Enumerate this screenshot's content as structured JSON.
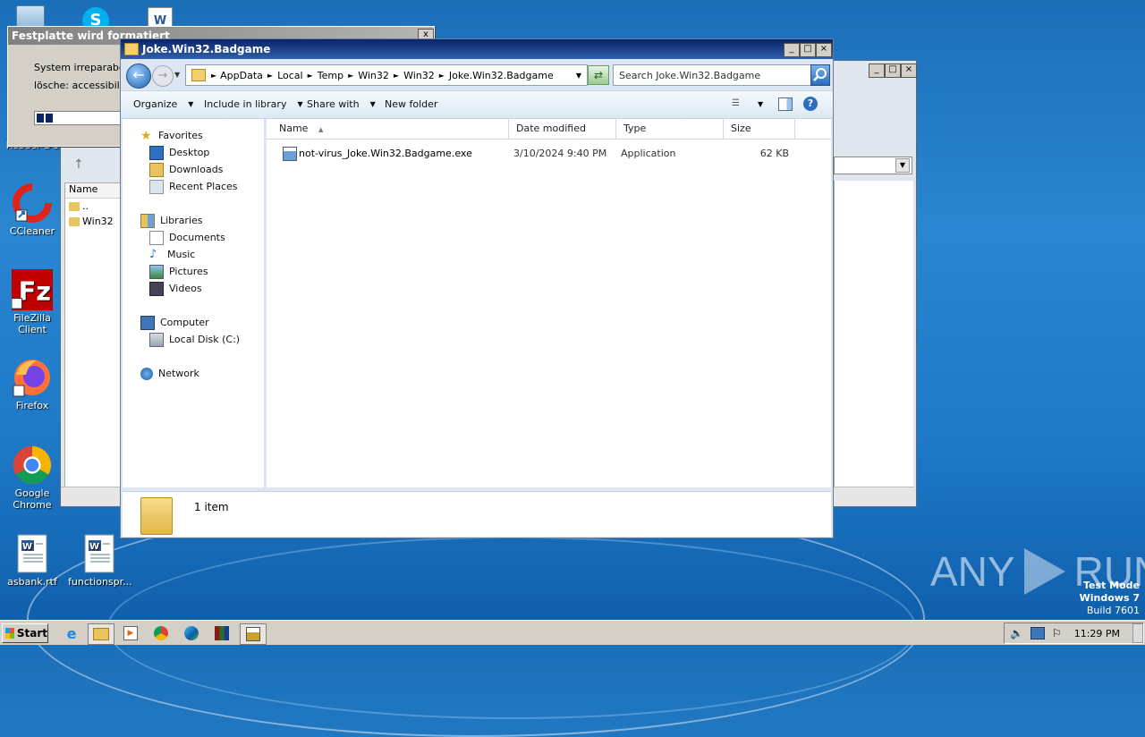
{
  "desktop": {
    "icons": [
      {
        "label": "Reader DC"
      },
      {
        "label": "CCleaner"
      },
      {
        "label": "FileZilla Client"
      },
      {
        "label": "Firefox"
      },
      {
        "label": "Google Chrome"
      },
      {
        "label": "asbank.rtf"
      },
      {
        "label": "functionspr..."
      }
    ],
    "watermark": "ANY",
    "watermark_run": "RUN",
    "test_mode": {
      "line1": "Test Mode",
      "line2": "Windows 7",
      "line3": "Build 7601"
    }
  },
  "format_window": {
    "title": "Festplatte wird formatiert",
    "line1": "System irreparabel b",
    "line2": "lösche: accessibilityc",
    "close": "x"
  },
  "bg_explorer": {
    "column_name": "Name",
    "rows": [
      {
        "name": ".."
      },
      {
        "name": "Win32"
      }
    ]
  },
  "explorer": {
    "title": "Joke.Win32.Badgame",
    "breadcrumb": [
      "AppData",
      "Local",
      "Temp",
      "Win32",
      "Win32",
      "Joke.Win32.Badgame"
    ],
    "search_placeholder": "Search Joke.Win32.Badgame",
    "toolbar": {
      "organize": "Organize",
      "include_in_library": "Include in library",
      "share_with": "Share with",
      "new_folder": "New folder"
    },
    "nav": {
      "favorites": "Favorites",
      "desktop": "Desktop",
      "downloads": "Downloads",
      "recent_places": "Recent Places",
      "libraries": "Libraries",
      "documents": "Documents",
      "music": "Music",
      "pictures": "Pictures",
      "videos": "Videos",
      "computer": "Computer",
      "local_disk": "Local Disk (C:)",
      "network": "Network"
    },
    "columns": {
      "name": "Name",
      "date": "Date modified",
      "type": "Type",
      "size": "Size"
    },
    "files": [
      {
        "name": "not-virus_Joke.Win32.Badgame.exe",
        "date": "3/10/2024 9:40 PM",
        "type": "Application",
        "size": "62 KB"
      }
    ],
    "status": "1 item"
  },
  "taskbar": {
    "start": "Start",
    "clock": "11:29 PM"
  }
}
